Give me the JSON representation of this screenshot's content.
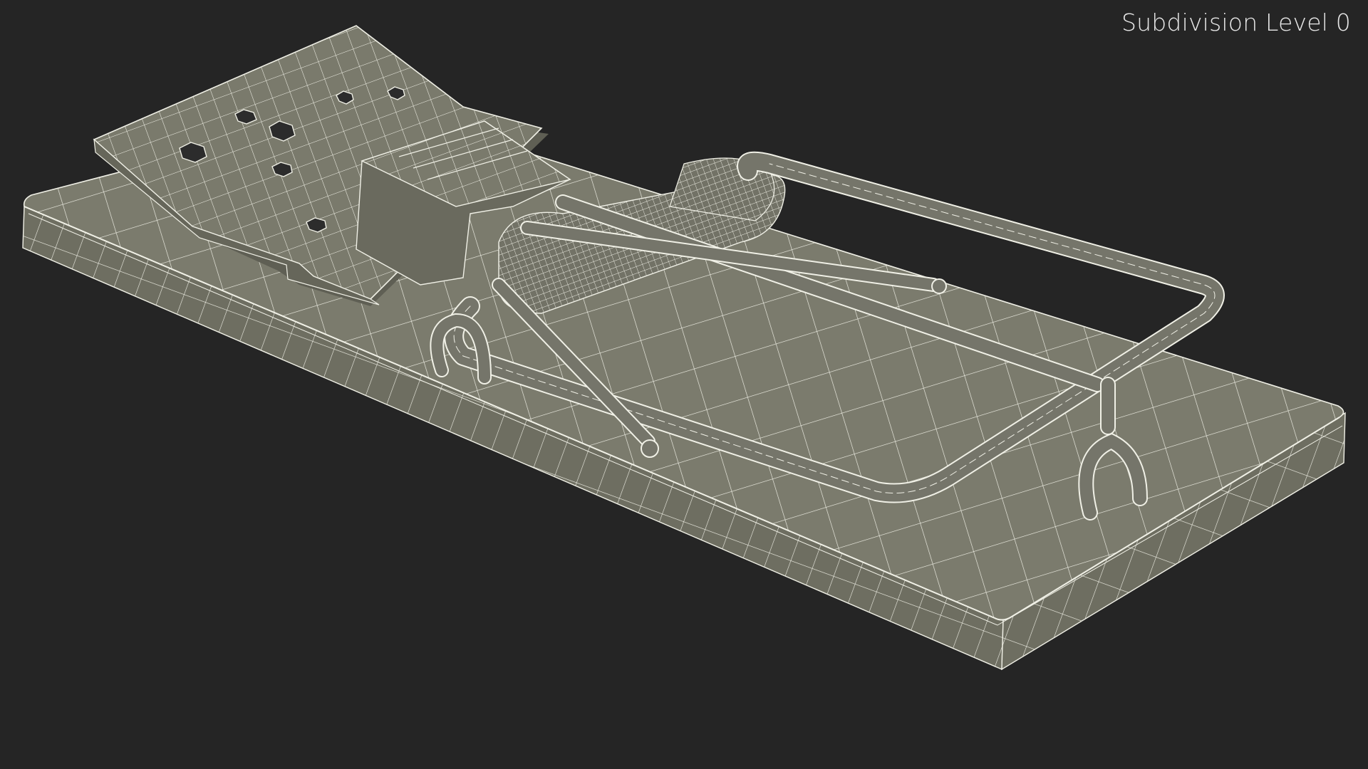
{
  "viewport": {
    "label": "Subdivision Level 0"
  },
  "scene": {
    "subject": "mousetrap-wireframe-model",
    "colors": {
      "background": "#252525",
      "surface_top": "#7a7a6c",
      "surface_side": "#6d6d60",
      "wire": "#f2f2ea",
      "hole": "#2c2c2c"
    }
  }
}
